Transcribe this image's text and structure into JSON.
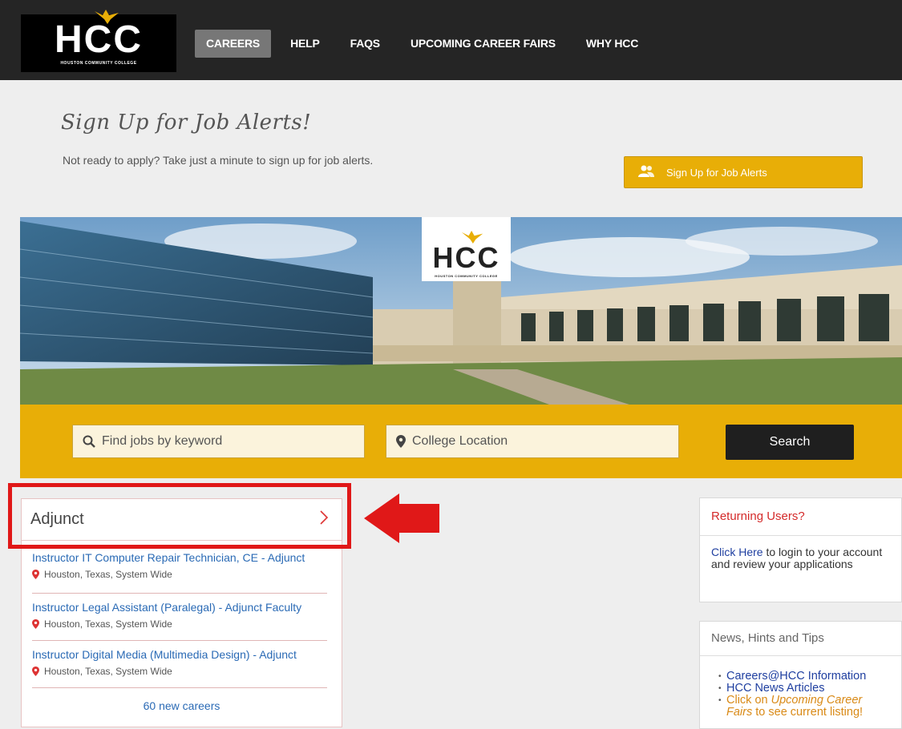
{
  "header": {
    "logo_text": "HCC",
    "logo_subtitle": "HOUSTON COMMUNITY COLLEGE",
    "nav": [
      {
        "label": "CAREERS",
        "active": true
      },
      {
        "label": "HELP",
        "active": false
      },
      {
        "label": "FAQS",
        "active": false
      },
      {
        "label": "UPCOMING CAREER FAIRS",
        "active": false
      },
      {
        "label": "WHY HCC",
        "active": false
      }
    ]
  },
  "signup": {
    "title": "Sign Up for Job Alerts!",
    "description": "Not ready to apply? Take just a minute to sign up for job alerts.",
    "button_label": "Sign Up for Job Alerts",
    "button_icon": "users-icon"
  },
  "hero": {
    "logo_text": "HCC",
    "logo_subtitle": "HOUSTON COMMUNITY COLLEGE"
  },
  "search": {
    "keyword_placeholder": "Find jobs by keyword",
    "location_placeholder": "College Location",
    "button_label": "Search"
  },
  "category": {
    "title": "Adjunct",
    "jobs": [
      {
        "title": "Instructor IT Computer Repair Technician, CE - Adjunct",
        "location": "Houston, Texas, System Wide"
      },
      {
        "title": "Instructor Legal Assistant (Paralegal) - Adjunct Faculty",
        "location": "Houston, Texas, System Wide"
      },
      {
        "title": "Instructor Digital Media (Multimedia Design) - Adjunct",
        "location": "Houston, Texas, System Wide"
      }
    ],
    "more_label": "60 new careers"
  },
  "returning": {
    "title": "Returning Users?",
    "link": "Click Here",
    "text": " to login to your account and review your applications"
  },
  "news": {
    "title": "News, Hints and Tips",
    "items": [
      {
        "text": "Careers@HCC Information"
      },
      {
        "text": "HCC News Articles"
      }
    ],
    "fairs": {
      "prefix": "Click on ",
      "em": "Upcoming Career Fairs",
      "suffix": " to see current listing!"
    }
  },
  "colors": {
    "accent": "#e8ae07",
    "nav_bg": "#252525",
    "link": "#2a6ab5",
    "highlight": "#e01818"
  }
}
